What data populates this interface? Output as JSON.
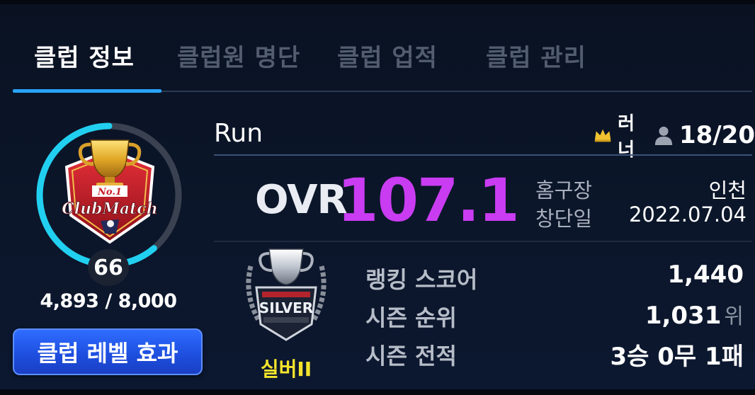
{
  "tabs": [
    {
      "label": "클럽 정보",
      "active": true
    },
    {
      "label": "클럽원 명단",
      "active": false
    },
    {
      "label": "클럽 업적",
      "active": false
    },
    {
      "label": "클럽 관리",
      "active": false
    }
  ],
  "club": {
    "name": "Run",
    "role": "러너",
    "members": "18/20",
    "ovr_label": "OVR",
    "ovr_value": "107.1",
    "home_label": "홈구장",
    "home_value": "인천",
    "founded_label": "창단일",
    "founded_value": "2022.07.04"
  },
  "level": {
    "value": "66",
    "exp_text": "4,893 / 8,000",
    "exp_current": 4893,
    "exp_max": 8000,
    "effect_button": "클럽 레벨 효과"
  },
  "emblem": {
    "top_text": "No.1",
    "main_text": "ClubMatch"
  },
  "tier": {
    "badge_text": "SILVER",
    "name": "실버II"
  },
  "stats": {
    "ranking_label": "랭킹 스코어",
    "ranking_value": "1,440",
    "rank_label": "시즌 순위",
    "rank_value": "1,031",
    "rank_unit": "위",
    "record_label": "시즌 전적",
    "record_value": "3승 0무 1패"
  },
  "colors": {
    "accent": "#2aa3ff",
    "ovr": "#c93cf2",
    "ring": "#21d0f0",
    "tier_name": "#f4e52c",
    "button": "#1e4fe0"
  }
}
